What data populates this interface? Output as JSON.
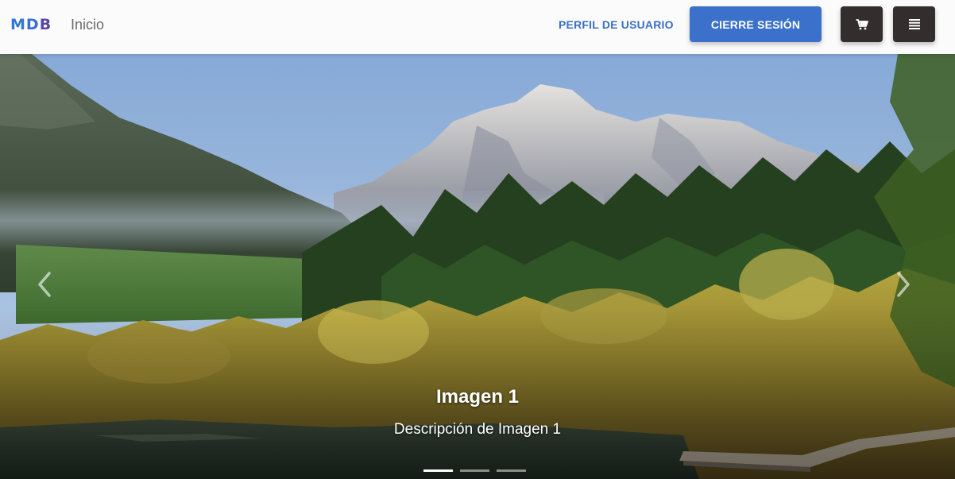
{
  "navbar": {
    "brand": {
      "letters": [
        "M",
        "D",
        "B"
      ]
    },
    "home_label": "Inicio",
    "profile_label": "PERFIL DE USUARIO",
    "logout_label": "CIERRE SESIÓN",
    "cart_icon": "cart-icon",
    "menu_icon": "menu-icon",
    "colors": {
      "primary": "#3b71ca",
      "dark_button": "#332d2d"
    }
  },
  "carousel": {
    "active_index": 0,
    "slide_count": 3,
    "slides": [
      {
        "title": "Imagen 1",
        "description": "Descripción de Imagen 1"
      }
    ],
    "prev_icon": "chevron-left-icon",
    "next_icon": "chevron-right-icon"
  }
}
